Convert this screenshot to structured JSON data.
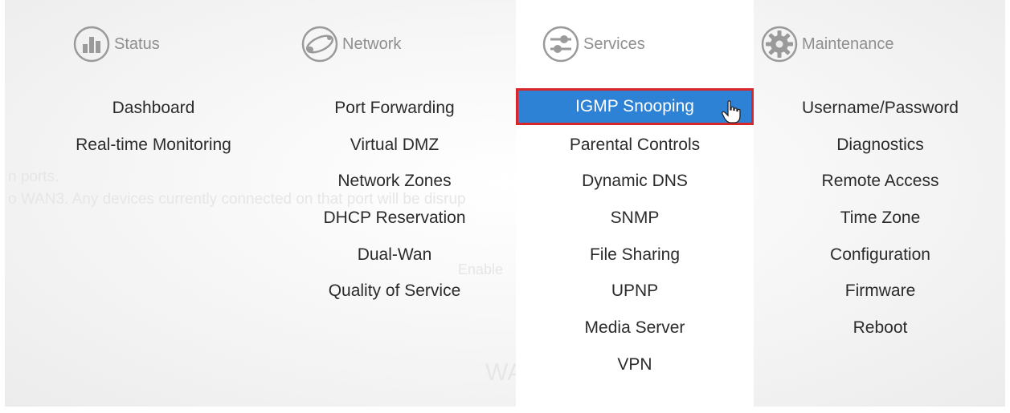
{
  "background_text": {
    "line1": "n ports.",
    "line2": "o WAN3. Any devices currently connected on that port will be disrup",
    "line3": "Enable",
    "line4": "WA"
  },
  "columns": [
    {
      "title": "Status",
      "icon": "bar-chart-icon",
      "items": [
        "Dashboard",
        "Real-time Monitoring"
      ]
    },
    {
      "title": "Network",
      "icon": "network-globe-icon",
      "items": [
        "Port Forwarding",
        "Virtual DMZ",
        "Network Zones",
        "DHCP Reservation",
        "Dual-Wan",
        "Quality of Service"
      ]
    },
    {
      "title": "Services",
      "icon": "sliders-icon",
      "items": [
        "IGMP Snooping",
        "Parental Controls",
        "Dynamic DNS",
        "SNMP",
        "File Sharing",
        "UPNP",
        "Media Server",
        "VPN"
      ]
    },
    {
      "title": "Maintenance",
      "icon": "gear-icon",
      "items": [
        "Username/Password",
        "Diagnostics",
        "Remote Access",
        "Time Zone",
        "Configuration",
        "Firmware",
        "Reboot"
      ]
    }
  ],
  "colors": {
    "active_bg": "#2e82d5",
    "highlight_border": "#d9262b",
    "header_text": "#8f8f8f",
    "menu_text": "#2b2b2b"
  }
}
